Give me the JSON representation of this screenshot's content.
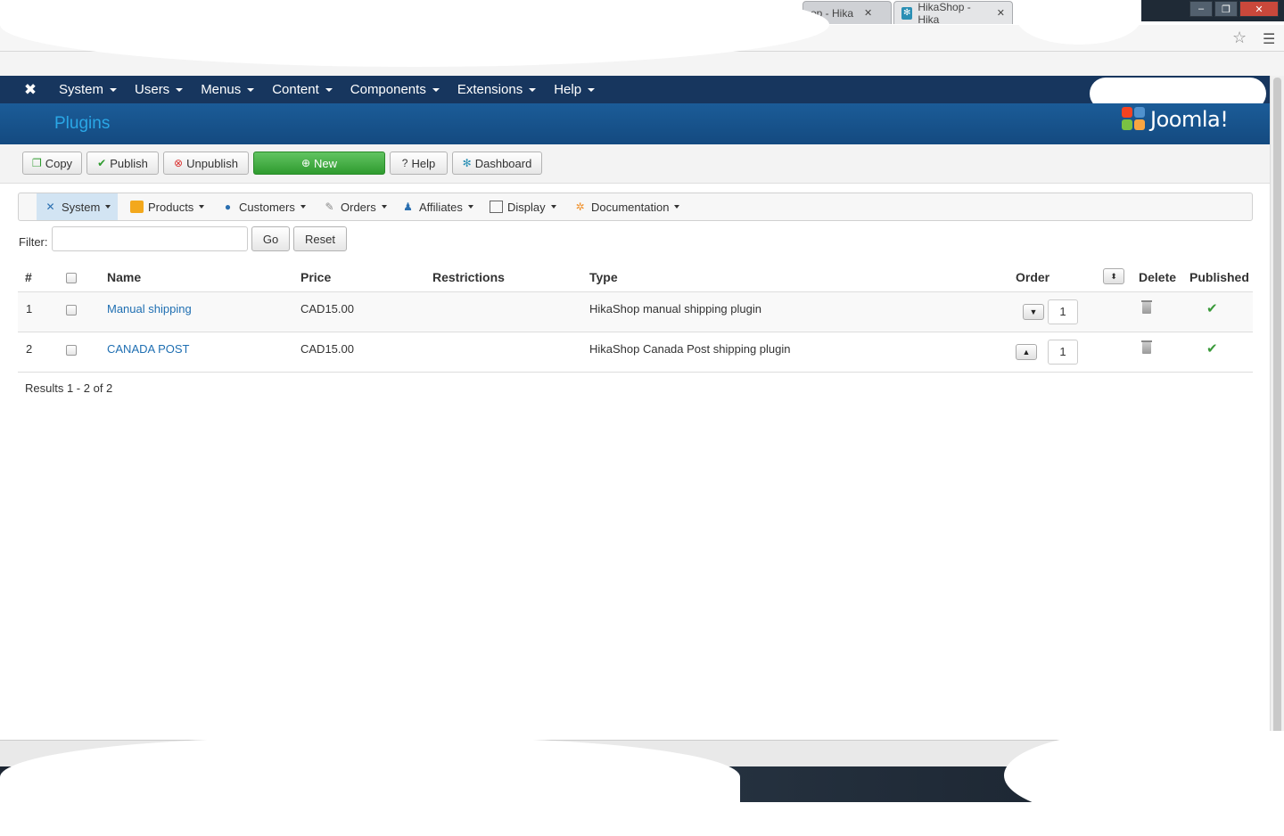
{
  "browser": {
    "tabs": [
      {
        "label": "op - Hika"
      },
      {
        "label": "HikaShop - Hika"
      }
    ]
  },
  "topnav": {
    "items": [
      "System",
      "Users",
      "Menus",
      "Content",
      "Components",
      "Extensions",
      "Help"
    ]
  },
  "header": {
    "title": "Plugins",
    "brand": "Joomla!"
  },
  "toolbar": {
    "copy": "Copy",
    "publish": "Publish",
    "unpublish": "Unpublish",
    "new": "New",
    "help": "Help",
    "dashboard": "Dashboard"
  },
  "submenu": {
    "items": [
      "System",
      "Products",
      "Customers",
      "Orders",
      "Affiliates",
      "Display",
      "Documentation"
    ]
  },
  "filter": {
    "label": "Filter:",
    "value": "",
    "go": "Go",
    "reset": "Reset"
  },
  "table": {
    "headers": {
      "num": "#",
      "name": "Name",
      "price": "Price",
      "restrictions": "Restrictions",
      "type": "Type",
      "order": "Order",
      "delete": "Delete",
      "published": "Published"
    },
    "rows": [
      {
        "num": "1",
        "name": "Manual shipping",
        "price": "CAD15.00",
        "restrictions": "",
        "type": "HikaShop manual shipping plugin",
        "order": "1"
      },
      {
        "num": "2",
        "name": "CANADA POST",
        "price": "CAD15.00",
        "restrictions": "",
        "type": "HikaShop Canada Post shipping plugin",
        "order": "1"
      }
    ]
  },
  "results": "Results 1 - 2 of 2",
  "colors": {
    "nav_bg": "#17365e",
    "header_bg": "#1b5c98",
    "title": "#2aa7e6",
    "new_button": "#3ea83e",
    "link": "#1f6fb2",
    "published_check": "#3a9a3a"
  }
}
